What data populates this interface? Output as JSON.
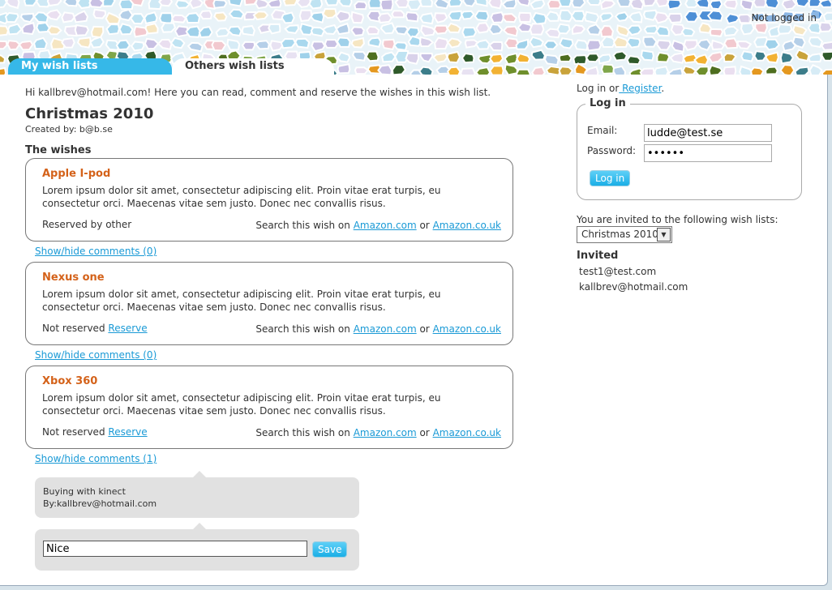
{
  "header": {
    "status": "Not logged in",
    "tabs": [
      "My wish lists",
      "Others wish lists"
    ]
  },
  "main": {
    "greeting": "Hi kallbrev@hotmail.com! Here you can read, comment and reserve the wishes in this wish list.",
    "title": "Christmas 2010",
    "created_by": "Created by: b@b.se",
    "wishes_heading": "The wishes",
    "search_prefix": "Search this wish on",
    "search_or": "or",
    "amazon_com": "Amazon.com",
    "amazon_uk": "Amazon.co.uk",
    "wishes": [
      {
        "title": "Apple I-pod",
        "description": "Lorem ipsum dolor sit amet, consectetur adipiscing elit. Proin vitae erat turpis, eu consectetur orci. Maecenas vitae sem justo. Donec nec convallis risus.",
        "status": "Reserved by other",
        "reserve_link": "",
        "comments_toggle": "Show/hide comments (0)"
      },
      {
        "title": "Nexus one",
        "description": "Lorem ipsum dolor sit amet, consectetur adipiscing elit. Proin vitae erat turpis, eu consectetur orci. Maecenas vitae sem justo. Donec nec convallis risus.",
        "status": "Not reserved",
        "reserve_link": "Reserve",
        "comments_toggle": "Show/hide comments (0)"
      },
      {
        "title": "Xbox 360",
        "description": "Lorem ipsum dolor sit amet, consectetur adipiscing elit. Proin vitae erat turpis, eu consectetur orci. Maecenas vitae sem justo. Donec nec convallis risus.",
        "status": "Not reserved",
        "reserve_link": "Reserve",
        "comments_toggle": "Show/hide comments (1)"
      }
    ],
    "comment": {
      "text": "Buying with kinect",
      "author": "By:kallbrev@hotmail.com"
    },
    "comment_form": {
      "value": "Nice",
      "save_label": "Save"
    }
  },
  "sidebar": {
    "login_text": "Log in or",
    "register_link": " Register",
    "login_period": ".",
    "login_legend": "Log in",
    "email_label": "Email:",
    "email_value": "ludde@test.se",
    "password_label": "Password:",
    "password_value": "••••••",
    "login_button": "Log in",
    "invited_lists_label": "You are invited to the following wish lists:",
    "selected_list": "Christmas 2010",
    "invited_heading": "Invited",
    "invitees": [
      "test1@test.com",
      "kallbrev@hotmail.com"
    ]
  },
  "colors": {
    "accent": "#36b8e8",
    "wish_title": "#d4621a",
    "link": "#1a9ad6",
    "bubble": "#e1e1e1"
  }
}
